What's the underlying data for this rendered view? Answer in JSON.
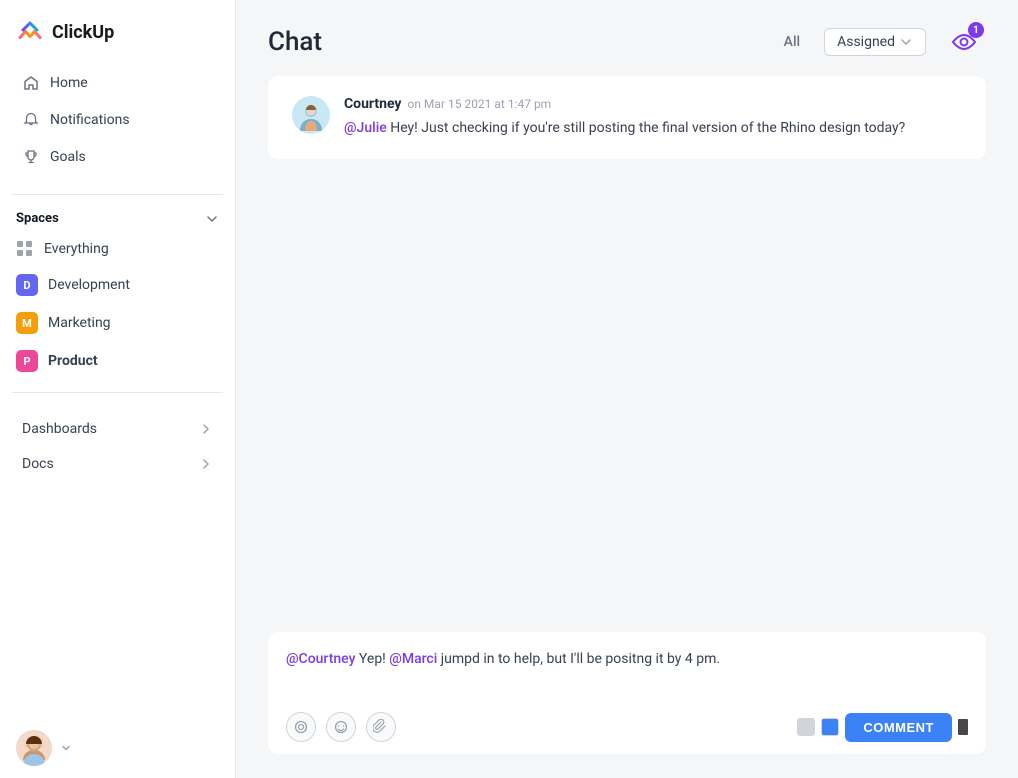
{
  "app": {
    "name": "ClickUp"
  },
  "sidebar": {
    "nav": [
      {
        "id": "home",
        "label": "Home",
        "icon": "home-icon"
      },
      {
        "id": "notifications",
        "label": "Notifications",
        "icon": "bell-icon"
      },
      {
        "id": "goals",
        "label": "Goals",
        "icon": "trophy-icon"
      }
    ],
    "spaces_label": "Spaces",
    "spaces": [
      {
        "id": "everything",
        "label": "Everything",
        "type": "grid",
        "color": ""
      },
      {
        "id": "development",
        "label": "Development",
        "type": "letter",
        "letter": "D",
        "color": "#6366f1"
      },
      {
        "id": "marketing",
        "label": "Marketing",
        "type": "letter",
        "letter": "M",
        "color": "#f59e0b"
      },
      {
        "id": "product",
        "label": "Product",
        "type": "letter",
        "letter": "P",
        "color": "#ec4899",
        "active": true
      }
    ],
    "footer_nav": [
      {
        "id": "dashboards",
        "label": "Dashboards"
      },
      {
        "id": "docs",
        "label": "Docs"
      }
    ]
  },
  "chat": {
    "title": "Chat",
    "filter_all": "All",
    "filter_assigned": "Assigned",
    "notification_badge": "1",
    "messages": [
      {
        "id": "msg1",
        "author": "Courtney",
        "time": "on Mar 15 2021 at 1:47 pm",
        "mention": "@Julie",
        "text": " Hey! Just checking if you're still posting the final version of the Rhino design today?"
      }
    ],
    "reply": {
      "mention1": "@Courtney",
      "text1": " Yep! ",
      "mention2": "@Marci",
      "text2": " jumpd in to help, but I'll be positng it by 4 pm."
    },
    "comment_button": "COMMENT"
  }
}
